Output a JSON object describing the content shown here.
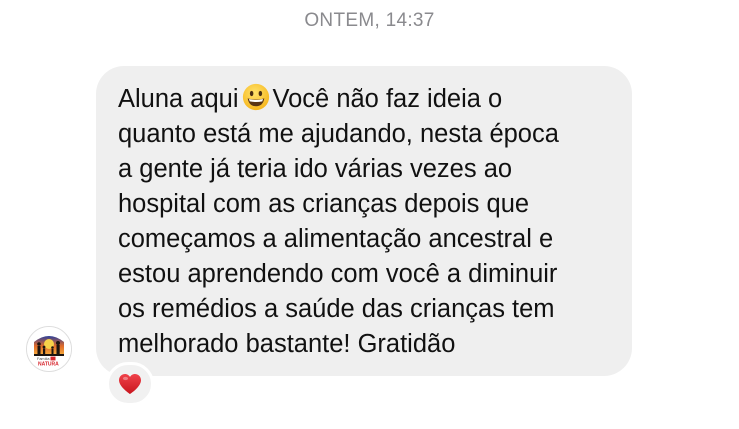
{
  "header": {
    "timestamp": "ONTEM, 14:37"
  },
  "message": {
    "line1_before_emoji": "Aluna aqui",
    "emoji": "grinning-face-icon",
    "line1_after_emoji": "Você não faz ideia o",
    "body": "quanto está me ajudando, nesta época\na gente já teria ido várias vezes ao\nhospital com as crianças depois que\ncomeçamos a alimentação ancestral e\nestou aprendendo com você a diminuir\nos remédios a saúde das crianças tem\nmelhorado bastante! Gratidão"
  },
  "avatar": {
    "logo_text": "Família\nNATURA"
  },
  "reaction": {
    "icon": "heart-icon",
    "color": "#e0232e"
  },
  "colors": {
    "bubble": "#efefef",
    "timestamp": "#8a8a8e",
    "text": "#111111"
  }
}
